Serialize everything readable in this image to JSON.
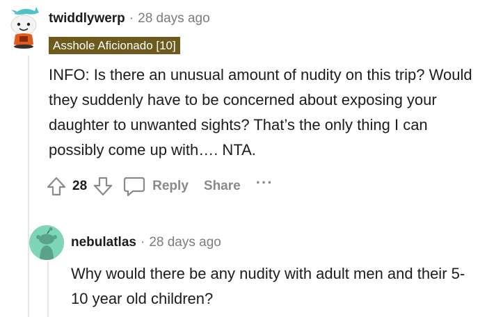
{
  "comment": {
    "username": "twiddlywerp",
    "separator": "·",
    "time": "28 days ago",
    "flair": "Asshole Aficionado [10]",
    "body": "INFO: Is there an unusual amount of nudity on this trip? Would they suddenly have to be concerned about exposing your daughter to unwanted sights? That’s the only thing I can possibly come up with…. NTA.",
    "score": "28",
    "reply_label": "Reply",
    "share_label": "Share",
    "more_label": "···",
    "icons": {
      "upvote": "upvote-arrow-icon",
      "downvote": "downvote-arrow-icon",
      "reply": "speech-bubble-icon",
      "avatar": "snoo-avatar-icon"
    }
  },
  "reply": {
    "username": "nebulatlas",
    "separator": "·",
    "time": "28 days ago",
    "body": "Why would there be any nudity with adult men and their 5-10 year old children?",
    "avatar_color": "#7fd6b6"
  },
  "colors": {
    "flair_bg": "#6e5a1d",
    "meta_gray": "#7c7c7c",
    "action_gray": "#878a8c"
  }
}
